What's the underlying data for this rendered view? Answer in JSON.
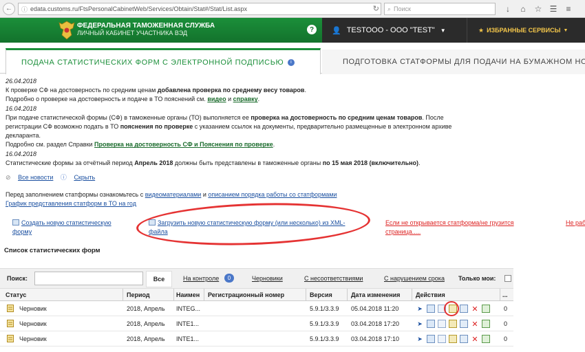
{
  "browser": {
    "url": "edata.customs.ru/FtsPersonalCabinetWeb/Services/Obtain/Stat#/Stat/List.aspx",
    "search_placeholder": "Поиск"
  },
  "header": {
    "title": "ФЕДЕРАЛЬНАЯ ТАМОЖЕННАЯ СЛУЖБА",
    "subtitle": "ЛИЧНЫЙ КАБИНЕТ УЧАСТНИКА ВЭД",
    "help": "?",
    "user": "TESTOOO - ООО \"TEST\"",
    "favorites": "ИЗБРАННЫЕ СЕРВИСЫ"
  },
  "tabs": {
    "active": "ПОДАЧА СТАТИСТИЧЕСКИХ ФОРМ С ЭЛЕКТРОННОЙ ПОДПИСЬЮ",
    "inactive": "ПОДГОТОВКА СТАТФОРМЫ ДЛЯ ПОДАЧИ НА БУМАЖНОМ НОСИ"
  },
  "news": {
    "n1_date": "26.04.2018",
    "n1_l1_a": "К проверке СФ на достоверность по средним ценам ",
    "n1_l1_b": "добавлена проверка по среднему весу товаров",
    "n1_l1_c": ".",
    "n1_l2_a": "Подробно о проверке на достоверность и подаче в ТО пояснений см. ",
    "n1_l2_link1": "видео",
    "n1_l2_and": " и ",
    "n1_l2_link2": "справку",
    "n1_l2_end": ".",
    "n2_date": "16.04.2018",
    "n2_l1_a": "При подаче статистической формы (СФ) в таможенные органы (ТО) выполняется ее ",
    "n2_l1_b": "проверка на достоверность по средним ценам товаров",
    "n2_l1_c": ". После",
    "n2_l2_a": "регистрации СФ возможно подать в ТО ",
    "n2_l2_b": "пояснения по проверке",
    "n2_l2_c": " с указанием ссылок на документы, предварительно размещенные в электронном архиве",
    "n2_l3": "декларанта.",
    "n2_l4_a": "Подробно см. раздел Справки ",
    "n2_l4_link": "Проверка на достоверность СФ и Пояснения по проверке",
    "n2_l4_end": ".",
    "n3_date": "16.04.2018",
    "n3_a": "Статистические формы за отчётный период ",
    "n3_b": "Апрель 2018",
    "n3_c": " должны быть представлены в таможенные органы ",
    "n3_d": "по 15 мая 2018 (включительно)",
    "n3_e": ".",
    "all_news": "Все новости",
    "hide": "Скрыть"
  },
  "pre_info": {
    "a": "Перед заполнением статформы ознакомьтесь с ",
    "link1": "видеоматериалами",
    "and": " и ",
    "link2": "описанием порядка работы со статформами",
    "schedule": "График представления статформ в ТО на год"
  },
  "actions": {
    "create": "Создать новую статистическую форму",
    "upload": "Загрузить новую статистическую форму (или несколько) из XML-файла",
    "not_open": "Если не открывается статформа/не грузится страница.....",
    "cut": "Не раб плаги"
  },
  "list_title": "Список статистических форм",
  "filter": {
    "search_label": "Поиск:",
    "all": "Все",
    "on_control": "На контроле",
    "on_control_count": "0",
    "drafts": "Черновики",
    "mismatch": "С несоответствиями",
    "late": "С нарушением срока",
    "only_mine": "Только мои:"
  },
  "table": {
    "headers": {
      "status": "Статус",
      "period": "Период",
      "name": "Наимен",
      "regnum": "Регистрационный номер",
      "version": "Версия",
      "date": "Дата изменения",
      "actions": "Действия",
      "more": "..."
    },
    "rows": [
      {
        "status": "Черновик",
        "period": "2018, Апрель",
        "name": "INTEG...",
        "regnum": "",
        "version": "5.9.1/3.3.9",
        "date": "05.04.2018 11:20",
        "count": "0"
      },
      {
        "status": "Черновик",
        "period": "2018, Апрель",
        "name": "INTE1...",
        "regnum": "",
        "version": "5.9.1/3.3.9",
        "date": "03.04.2018 17:20",
        "count": "0"
      },
      {
        "status": "Черновик",
        "period": "2018, Апрель",
        "name": "INTE1...",
        "regnum": "",
        "version": "5.9.1/3.3.9",
        "date": "03.04.2018 17:10",
        "count": "0"
      }
    ]
  },
  "colors": {
    "brand_green": "#1b8f3a",
    "dark": "#2b2b2b",
    "accent_gold": "#f3c64a",
    "annotation_red": "#e53333"
  }
}
